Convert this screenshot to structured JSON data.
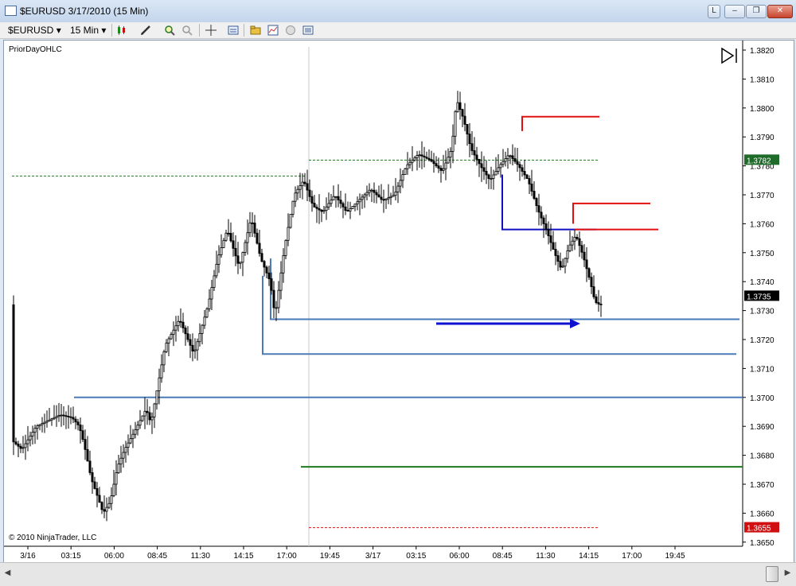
{
  "window": {
    "title": "$EURUSD  3/17/2010 (15 Min)",
    "controls": [
      "L",
      "–",
      "❐",
      "✕"
    ]
  },
  "toolbar": {
    "instrument": "$EURUSD",
    "interval": "15 Min",
    "dropdown_glyph": "▾",
    "icons": [
      "candlestick-style-icon",
      "pencil-draw-icon",
      "zoom-in-icon",
      "zoom-out-icon",
      "crosshair-icon",
      "data-box-icon",
      "instrument-folder-icon",
      "chart-indicators-icon",
      "strategy-icon",
      "properties-icon"
    ]
  },
  "chart": {
    "indicator_label": "PriorDayOHLC",
    "copyright": "© 2010 NinjaTrader, LLC",
    "y_ticks": [
      "1.3820",
      "1.3810",
      "1.3800",
      "1.3790",
      "1.3780",
      "1.3770",
      "1.3760",
      "1.3750",
      "1.3740",
      "1.3730",
      "1.3720",
      "1.3710",
      "1.3700",
      "1.3690",
      "1.3680",
      "1.3670",
      "1.3660",
      "1.3650"
    ],
    "x_ticks": [
      "3/16",
      "03:15",
      "06:00",
      "08:45",
      "11:30",
      "14:15",
      "17:00",
      "19:45",
      "3/17",
      "03:15",
      "06:00",
      "08:45",
      "11:30",
      "14:15",
      "17:00",
      "19:45"
    ],
    "price_markers": [
      {
        "label": "1.3782",
        "price": 1.3782,
        "color": "#1e6b2a"
      },
      {
        "label": "1.3735",
        "price": 1.3735,
        "color": "#000000"
      },
      {
        "label": "1.3655",
        "price": 1.3655,
        "color": "#d01010"
      }
    ],
    "colors": {
      "up": "#ffffff",
      "down": "#000000",
      "wick": "#000000",
      "red_level": "#e01010",
      "blue_level": "#1010c0",
      "steel_level": "#4a7ab8",
      "green_level": "#1e7a1e",
      "arrow": "#1010d0"
    }
  }
}
